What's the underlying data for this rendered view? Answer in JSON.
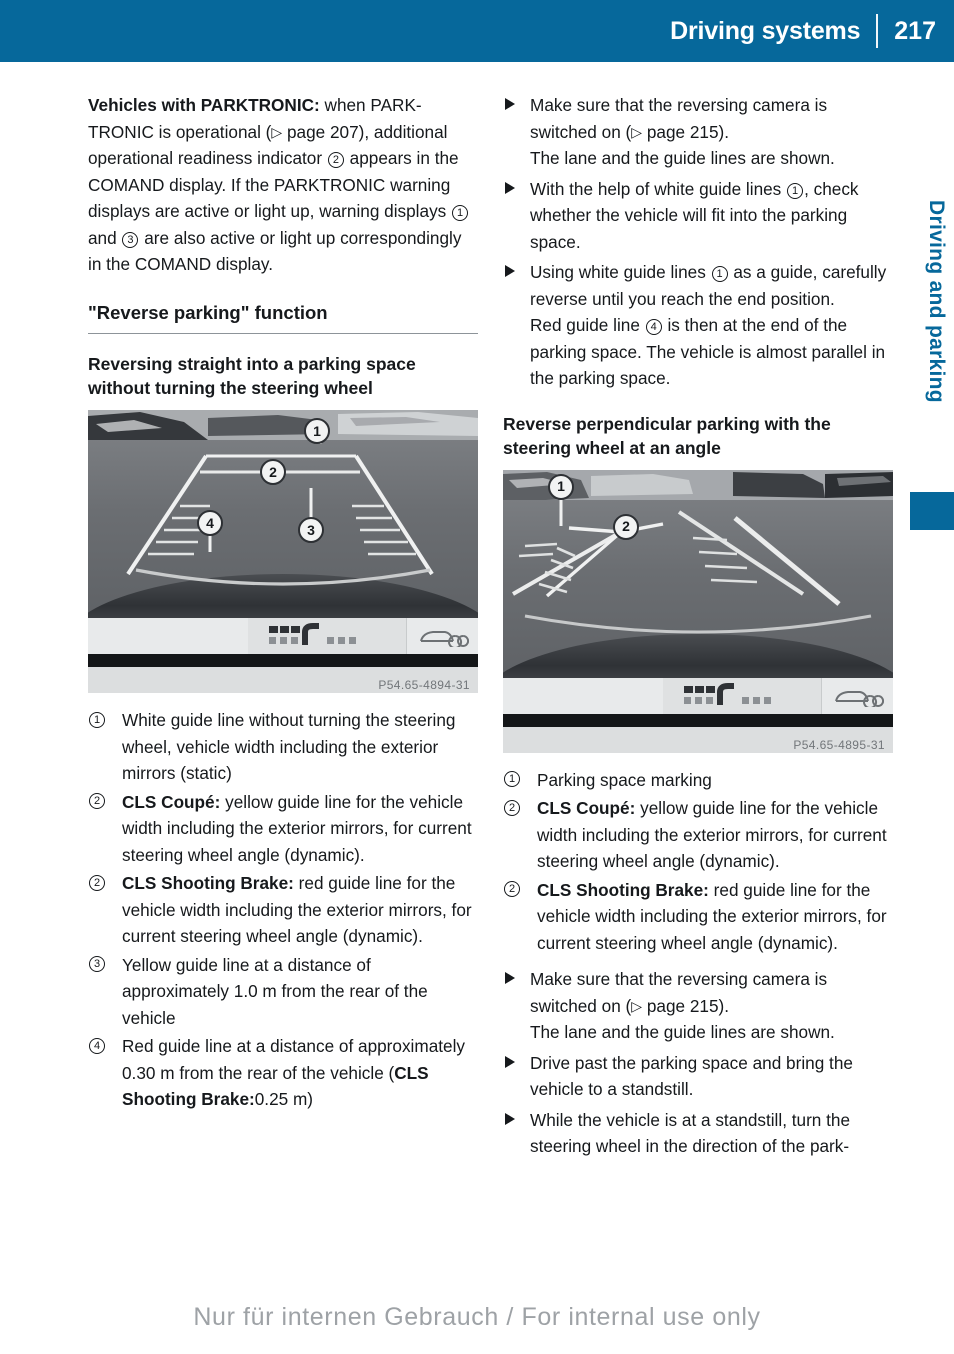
{
  "header": {
    "title": "Driving systems",
    "page_number": "217"
  },
  "side_tab": {
    "label": "Driving and parking"
  },
  "left_column": {
    "intro_paragraph": {
      "lead": "Vehicles with PARKTRONIC:",
      "t1": " when PARK-TRONIC is operational (",
      "ref1_glyph": "▷",
      "t2": " page 207), additional operational readiness indicator ",
      "c1": "2",
      "t3": " appears in the COMAND display. If the PARKTRONIC warning displays are active or light up, warning displays ",
      "c2": "1",
      "t4": " and ",
      "c3": "3",
      "t5": " are also active or light up correspondingly in the COMAND display."
    },
    "section_heading": "\"Reverse parking\" function",
    "subheading": "Reversing straight into a parking space without turning the steering wheel",
    "figure": {
      "code": "P54.65-4894-31",
      "callouts": [
        "1",
        "2",
        "3",
        "4"
      ]
    },
    "definitions": [
      {
        "marker": "1",
        "bold": "",
        "text": "White guide line without turning the steering wheel, vehicle width including the exterior mirrors (static)"
      },
      {
        "marker": "2",
        "bold": "CLS Coupé:",
        "text": " yellow guide line for the vehicle width including the exterior mirrors, for current steering wheel angle (dynamic)."
      },
      {
        "marker": "2",
        "bold": "CLS Shooting Brake:",
        "text": " red guide line for the vehicle width including the exterior mirrors, for current steering wheel angle (dynamic)."
      },
      {
        "marker": "3",
        "bold": "",
        "text": "Yellow guide line at a distance of approximately 1.0 m from the rear of the vehicle"
      },
      {
        "marker": "4",
        "bold": "",
        "text": "Red guide line at a distance of approximately 0.30 m from the rear of the vehicle (",
        "bold_tail": "CLS Shooting Brake:",
        "tail": "0.25 m)"
      }
    ]
  },
  "right_column": {
    "steps_top": [
      {
        "t1": "Make sure that the reversing camera is switched on (",
        "ref_glyph": "▷",
        "t2": " page 215).",
        "note": "The lane and the guide lines are shown."
      },
      {
        "t1": "With the help of white guide lines ",
        "c1": "1",
        "t2": ", check whether the vehicle will fit into the parking space.",
        "note": ""
      },
      {
        "t1": "Using white guide lines ",
        "c1": "1",
        "t2": " as a guide, carefully reverse until you reach the end position.",
        "note_pre": "Red guide line ",
        "note_c": "4",
        "note_post": " is then at the end of the parking space. The vehicle is almost parallel in the parking space."
      }
    ],
    "subheading": "Reverse perpendicular parking with the steering wheel at an angle",
    "figure": {
      "code": "P54.65-4895-31",
      "callouts": [
        "1",
        "2"
      ]
    },
    "definitions": [
      {
        "marker": "1",
        "bold": "",
        "text": "Parking space marking"
      },
      {
        "marker": "2",
        "bold": "CLS Coupé:",
        "text": " yellow guide line for the vehicle width including the exterior mirrors, for current steering wheel angle (dynamic)."
      },
      {
        "marker": "2",
        "bold": "CLS Shooting Brake:",
        "text": " red guide line for the vehicle width including the exterior mirrors, for current steering wheel angle (dynamic)."
      }
    ],
    "steps_bottom": [
      {
        "t1": "Make sure that the reversing camera is switched on (",
        "ref_glyph": "▷",
        "t2": " page 215).",
        "note": "The lane and the guide lines are shown."
      },
      {
        "t1": "Drive past the parking space and bring the vehicle to a standstill.",
        "note": ""
      },
      {
        "t1": "While the vehicle is at a standstill, turn the steering wheel in the direction of the park-",
        "note": ""
      }
    ]
  },
  "footer": {
    "watermark": "Nur für internen Gebrauch / For internal use only"
  },
  "colors": {
    "brand_blue": "#06689b",
    "text": "#16191c",
    "rule": "#8d9499"
  }
}
